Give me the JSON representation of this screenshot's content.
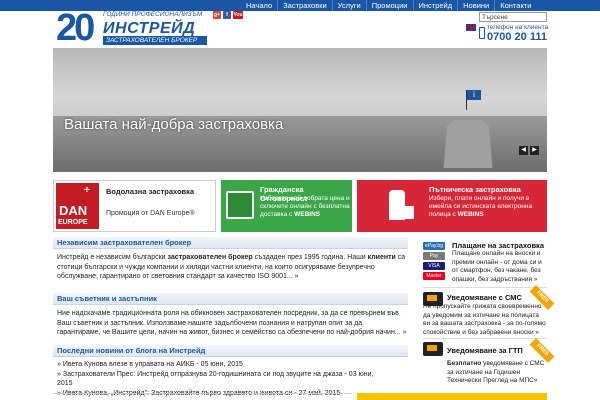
{
  "nav": {
    "items": [
      "Начало",
      "Застраховки",
      "Услуги",
      "Промоции",
      "Инстрейд",
      "Новини",
      "Контакти"
    ]
  },
  "logo": {
    "number": "20",
    "tagline": "ГОДИНИ ПРОФЕСИОНАЛИЗЪМ",
    "name": "ИНСТРЕЙД",
    "subtitle": "ЗАСТРАХОВАТЕЛЕН БРОКЕР"
  },
  "social": [
    "g+",
    "f",
    "You"
  ],
  "search": {
    "value": "Търсене"
  },
  "phone": {
    "label": "телефон на клиента",
    "number": "0700 20 111"
  },
  "hero": {
    "title": "Вашата най-добра застраховка",
    "prev": "◀",
    "next": "▶",
    "flag_letter": "i"
  },
  "promos": {
    "dive": {
      "title": "Водолазна застраховка",
      "desc": "Промоция от DAN Europe®",
      "logo_plus": "+",
      "logo_dan": "DAN",
      "logo_europe": "EUROPE"
    },
    "civil": {
      "title": "Гражданска Отговорност",
      "desc_plain": "Изберете най-добрата цена и сключете онлайн с безплатна доставка с ",
      "desc_strong": "WEBINS"
    },
    "travel": {
      "title": "Пътническа застраховка",
      "desc_plain": "Избери, плати онлайн и получи в имейла си истинската електронна полица с ",
      "desc_strong": "WEBINS"
    }
  },
  "sections": {
    "broker": {
      "heading": "Независим застрахователен брокер",
      "p1": "Инстрейд е независим български ",
      "b1": "застрахователен брокер",
      "p2": " създаден през 1995 година. Наши ",
      "b2": "клиенти",
      "p3": " са стотици български и чужди компании и хиляди частни клиенти, на които осигуряваме безупречно обслужване, гарантирано от световния стандарт за качество ISO 9001... »"
    },
    "advisor": {
      "heading": "Ваш съветник и застъпник",
      "text": "Ние надскачаме традиционната роля на обикновен застрахователен посредник, за да се превърнем във Ваш съветник и застъпник. Използваме нашите задълбочени познания и натрупан опит за да гарантираме, че Вашите цели, начин на живот, бизнес и семейство са обезпечени по най-добрия начин... »"
    },
    "news": {
      "heading": "Последни новини от блога на Инстрейд",
      "items": [
        "» Ивета Кунова влезе в управата на АИКБ - 05 юни, 2015",
        "» Застрахователи Прес: Инстрейд отпразнува 20-годишнината си под звуците на джаза - 03 юни, 2015",
        "» Ивета Кунова, „Инстрейд\": Застраховайте първо здравето и живота си - 27 май, 2015"
      ]
    }
  },
  "side": {
    "payment": {
      "title": "Плащане на застраховка",
      "text": "Плащане онлайн на вноски и премии онлайн - от дома си и от смартфон, без чакане, без опашки, без задръствания »",
      "cards": [
        "ePay.bg",
        "Pay",
        "VISA",
        "Master"
      ]
    },
    "sms": {
      "title": "Уведомяване с СМС",
      "text": "Не пропускайте грижата своевременно да уведомим за изтичане на полицата ви за вашата застраховка - за по-голямо спокойствие и без забравени вноски »",
      "badge": "FREE"
    },
    "gtp": {
      "title": "Уведомяване за ГТП",
      "strong": "Безплатно",
      "text": " уведомяване с СМС за изтичане на Годишен Технически Преглед на МПС»",
      "badge": "FREE"
    }
  },
  "colors": {
    "brand_blue": "#1a56a6",
    "green": "#3aa648",
    "red": "#d72638",
    "orange": "#f5a400"
  }
}
